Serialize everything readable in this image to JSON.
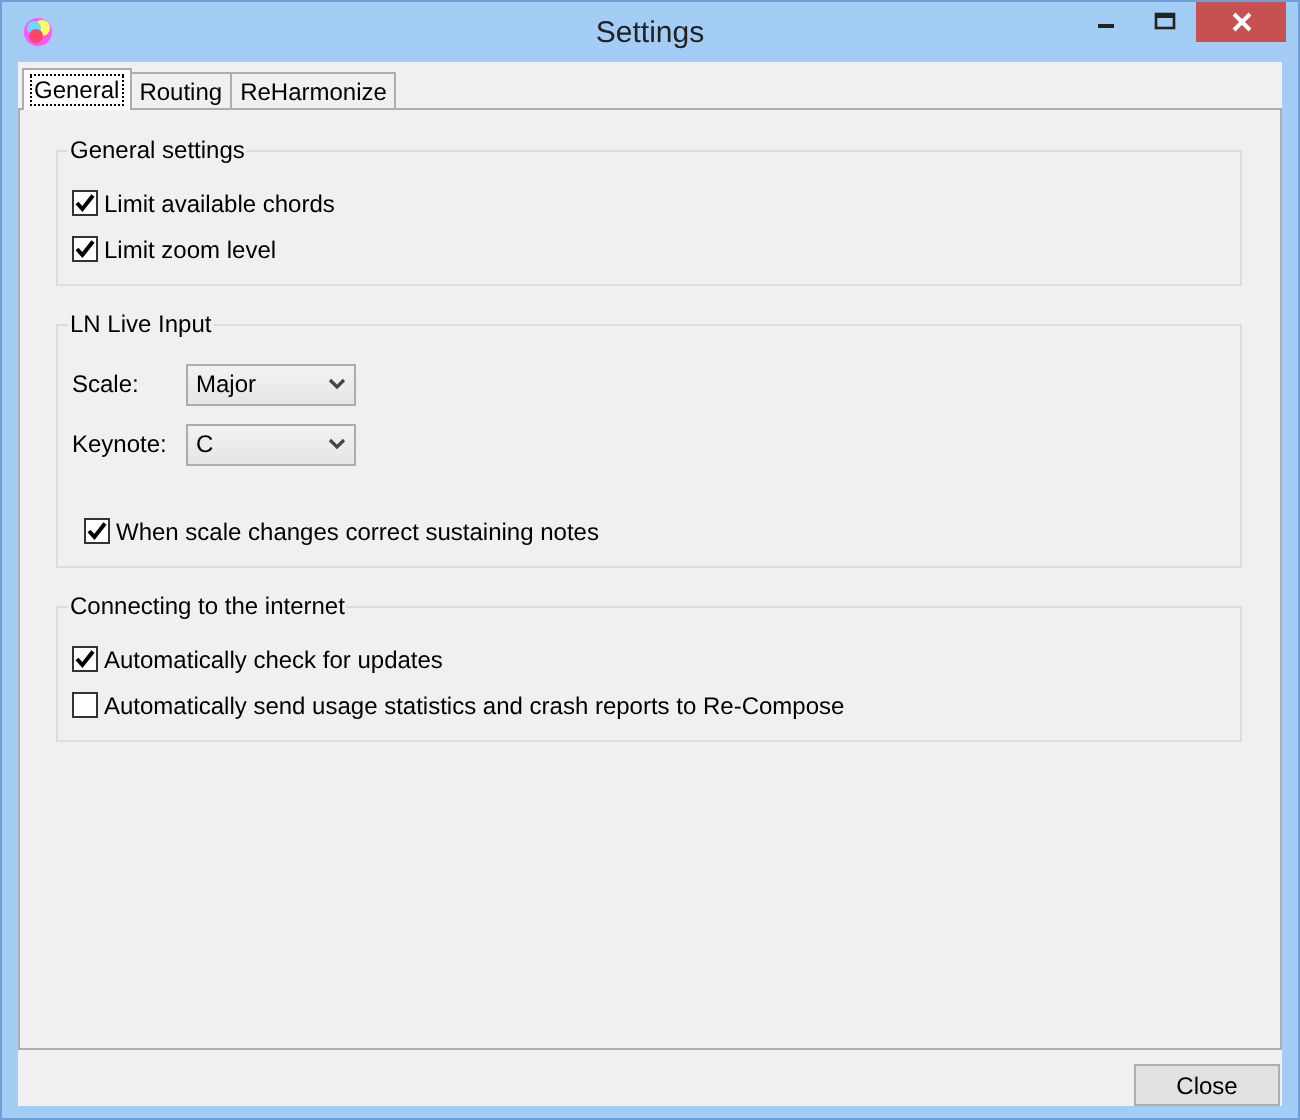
{
  "window": {
    "title": "Settings"
  },
  "tabs": [
    {
      "label": "General",
      "selected": true
    },
    {
      "label": "Routing",
      "selected": false
    },
    {
      "label": "ReHarmonize",
      "selected": false
    }
  ],
  "groups": [
    {
      "title": "General settings",
      "items": [
        {
          "kind": "checkbox",
          "label": "Limit available chords",
          "checked": true
        },
        {
          "kind": "checkbox",
          "label": "Limit zoom level",
          "checked": true
        }
      ]
    },
    {
      "title": "LN Live Input",
      "items": [
        {
          "kind": "select",
          "label": "Scale:",
          "value": "Major"
        },
        {
          "kind": "select",
          "label": "Keynote:",
          "value": "C"
        },
        {
          "kind": "checkbox",
          "label": "When scale changes correct sustaining notes",
          "checked": true
        }
      ]
    },
    {
      "title": "Connecting to the internet",
      "items": [
        {
          "kind": "checkbox",
          "label": "Automatically check for updates",
          "checked": true
        },
        {
          "kind": "checkbox",
          "label": "Automatically send usage statistics and crash reports to Re-Compose",
          "checked": false
        }
      ]
    }
  ],
  "buttons": [
    "Close"
  ]
}
